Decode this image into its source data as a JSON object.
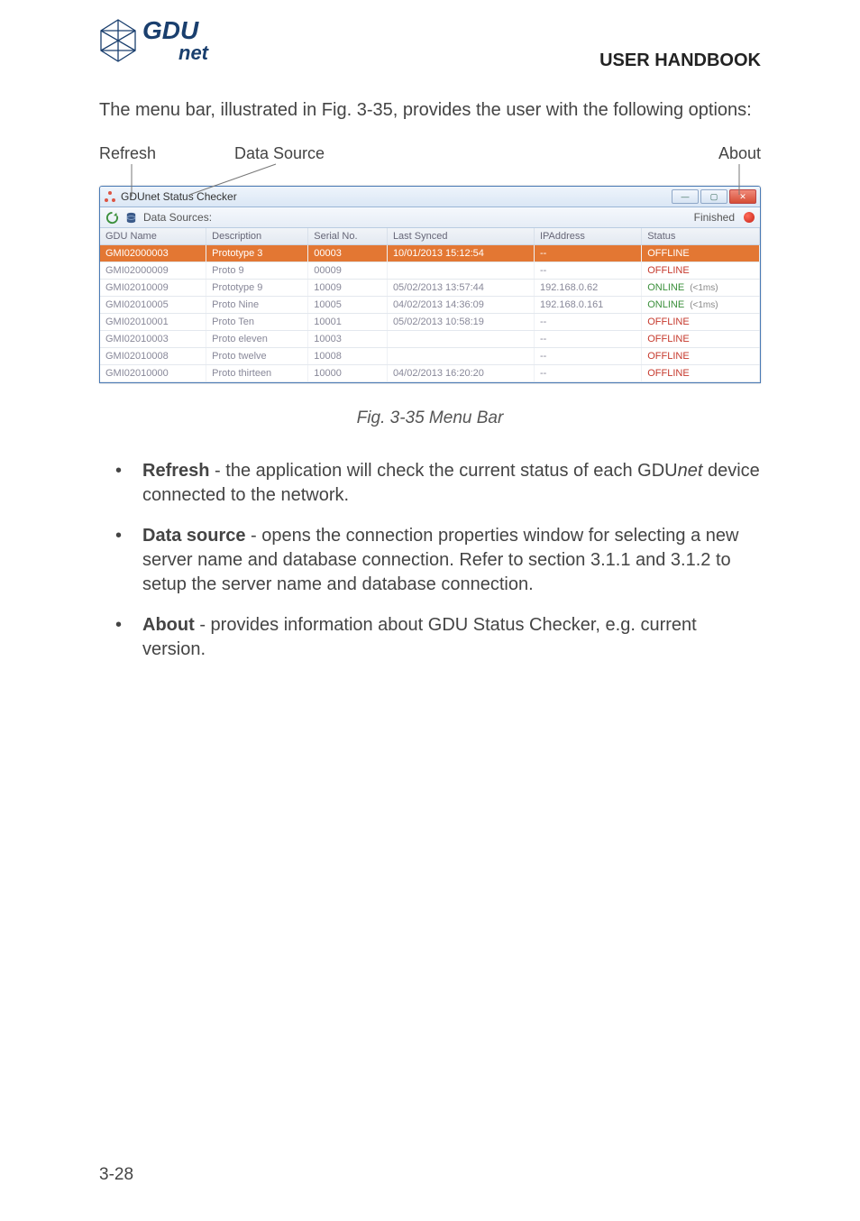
{
  "header": {
    "logo_top": "GDU",
    "logo_bottom": "net",
    "handbook_title": "USER HANDBOOK"
  },
  "intro_text": "The menu bar, illustrated in Fig. 3-35, provides the user with the following options:",
  "labels": {
    "refresh": "Refresh",
    "data_source": "Data Source",
    "about": "About"
  },
  "window": {
    "title": "GDUnet Status Checker",
    "toolbar_label": "Data Sources:",
    "finished": "Finished"
  },
  "columns": {
    "c0": "GDU Name",
    "c1": "Description",
    "c2": "Serial No.",
    "c3": "Last Synced",
    "c4": "IPAddress",
    "c5": "Status"
  },
  "rows": [
    {
      "name": "GMI02000003",
      "desc": "Prototype 3",
      "serial": "00003",
      "synced": "10/01/2013 15:12:54",
      "ip": "--",
      "status": "OFFLINE",
      "ms": "",
      "sel": true
    },
    {
      "name": "GMI02000009",
      "desc": "Proto 9",
      "serial": "00009",
      "synced": "",
      "ip": "--",
      "status": "OFFLINE",
      "ms": ""
    },
    {
      "name": "GMI02010009",
      "desc": "Prototype 9",
      "serial": "10009",
      "synced": "05/02/2013 13:57:44",
      "ip": "192.168.0.62",
      "status": "ONLINE",
      "ms": "(<1ms)"
    },
    {
      "name": "GMI02010005",
      "desc": "Proto Nine",
      "serial": "10005",
      "synced": "04/02/2013 14:36:09",
      "ip": "192.168.0.161",
      "status": "ONLINE",
      "ms": "(<1ms)"
    },
    {
      "name": "GMI02010001",
      "desc": "Proto Ten",
      "serial": "10001",
      "synced": "05/02/2013 10:58:19",
      "ip": "--",
      "status": "OFFLINE",
      "ms": ""
    },
    {
      "name": "GMI02010003",
      "desc": "Proto eleven",
      "serial": "10003",
      "synced": "",
      "ip": "--",
      "status": "OFFLINE",
      "ms": ""
    },
    {
      "name": "GMI02010008",
      "desc": "Proto twelve",
      "serial": "10008",
      "synced": "",
      "ip": "--",
      "status": "OFFLINE",
      "ms": ""
    },
    {
      "name": "GMI02010000",
      "desc": "Proto thirteen",
      "serial": "10000",
      "synced": "04/02/2013 16:20:20",
      "ip": "--",
      "status": "OFFLINE",
      "ms": ""
    }
  ],
  "figure_caption": "Fig. 3-35  Menu Bar",
  "bullets": {
    "b1_strong": "Refresh",
    "b1_rest": " - the application will check the current status of each GDU",
    "b1_ital": "net",
    "b1_tail": " device connected to the network.",
    "b2_strong": "Data source",
    "b2_rest": " - opens the connection properties window for selecting a new server name and database connection. Refer to section 3.1.1 and 3.1.2 to setup the server name and database connection.",
    "b3_strong": "About",
    "b3_rest": " - provides information about GDU Status Checker, e.g. current version."
  },
  "page_number": "3-28"
}
